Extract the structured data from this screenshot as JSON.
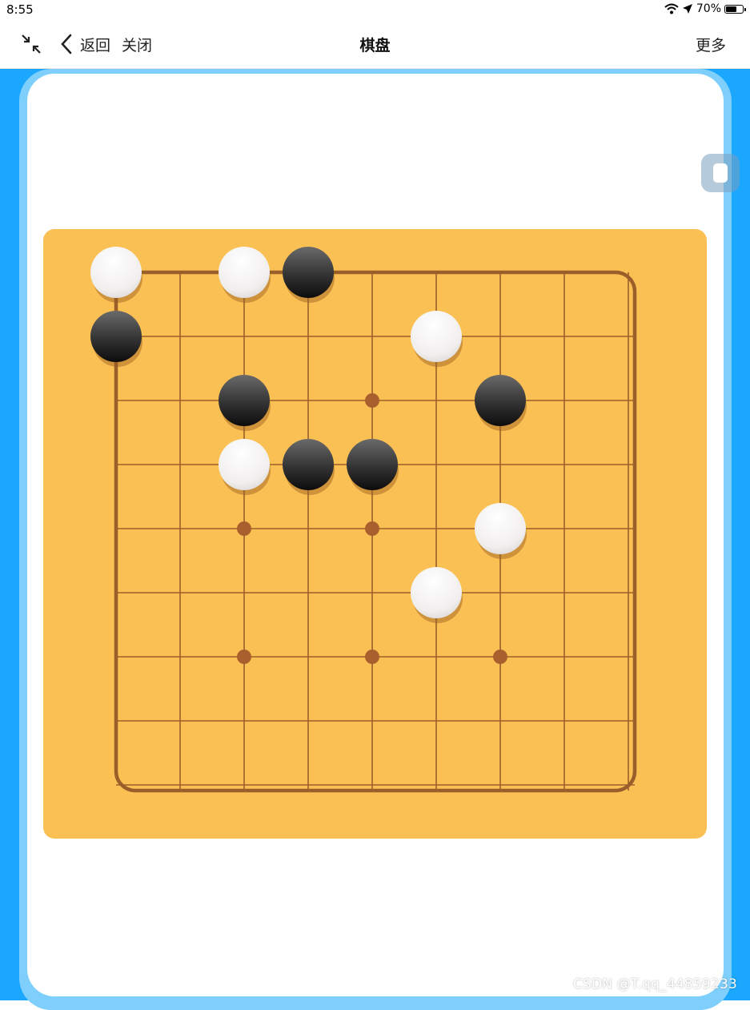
{
  "status_bar": {
    "time": "8:55",
    "battery_text": "70%",
    "battery_level": 0.7,
    "icons": [
      "wifi-icon",
      "location-arrow-icon",
      "battery-icon"
    ]
  },
  "nav": {
    "back_label": "返回",
    "close_label": "关闭",
    "title": "棋盘",
    "more_label": "更多",
    "icons": [
      "collapse-icon",
      "chevron-left-icon"
    ]
  },
  "board": {
    "size": 9,
    "star_points": [
      [
        4,
        2
      ],
      [
        2,
        4
      ],
      [
        4,
        4
      ],
      [
        2,
        6
      ],
      [
        4,
        6
      ],
      [
        6,
        6
      ]
    ],
    "stones": [
      {
        "color": "white",
        "col": 0,
        "row": 0
      },
      {
        "color": "white",
        "col": 2,
        "row": 0
      },
      {
        "color": "black",
        "col": 3,
        "row": 0
      },
      {
        "color": "black",
        "col": 0,
        "row": 1
      },
      {
        "color": "white",
        "col": 5,
        "row": 1
      },
      {
        "color": "black",
        "col": 2,
        "row": 2
      },
      {
        "color": "black",
        "col": 6,
        "row": 2
      },
      {
        "color": "white",
        "col": 2,
        "row": 3
      },
      {
        "color": "black",
        "col": 3,
        "row": 3
      },
      {
        "color": "black",
        "col": 4,
        "row": 3
      },
      {
        "color": "white",
        "col": 6,
        "row": 4
      },
      {
        "color": "white",
        "col": 5,
        "row": 5
      }
    ],
    "colors": {
      "board": "#fbc053",
      "line": "#9c5f2a",
      "border": "#9a5e2b",
      "star": "#a9602c"
    }
  },
  "colors": {
    "frame_blue": "#1aa7fd",
    "frame_light_blue": "#7fcffd"
  },
  "watermark": "CSDN @T.qq_44859233"
}
